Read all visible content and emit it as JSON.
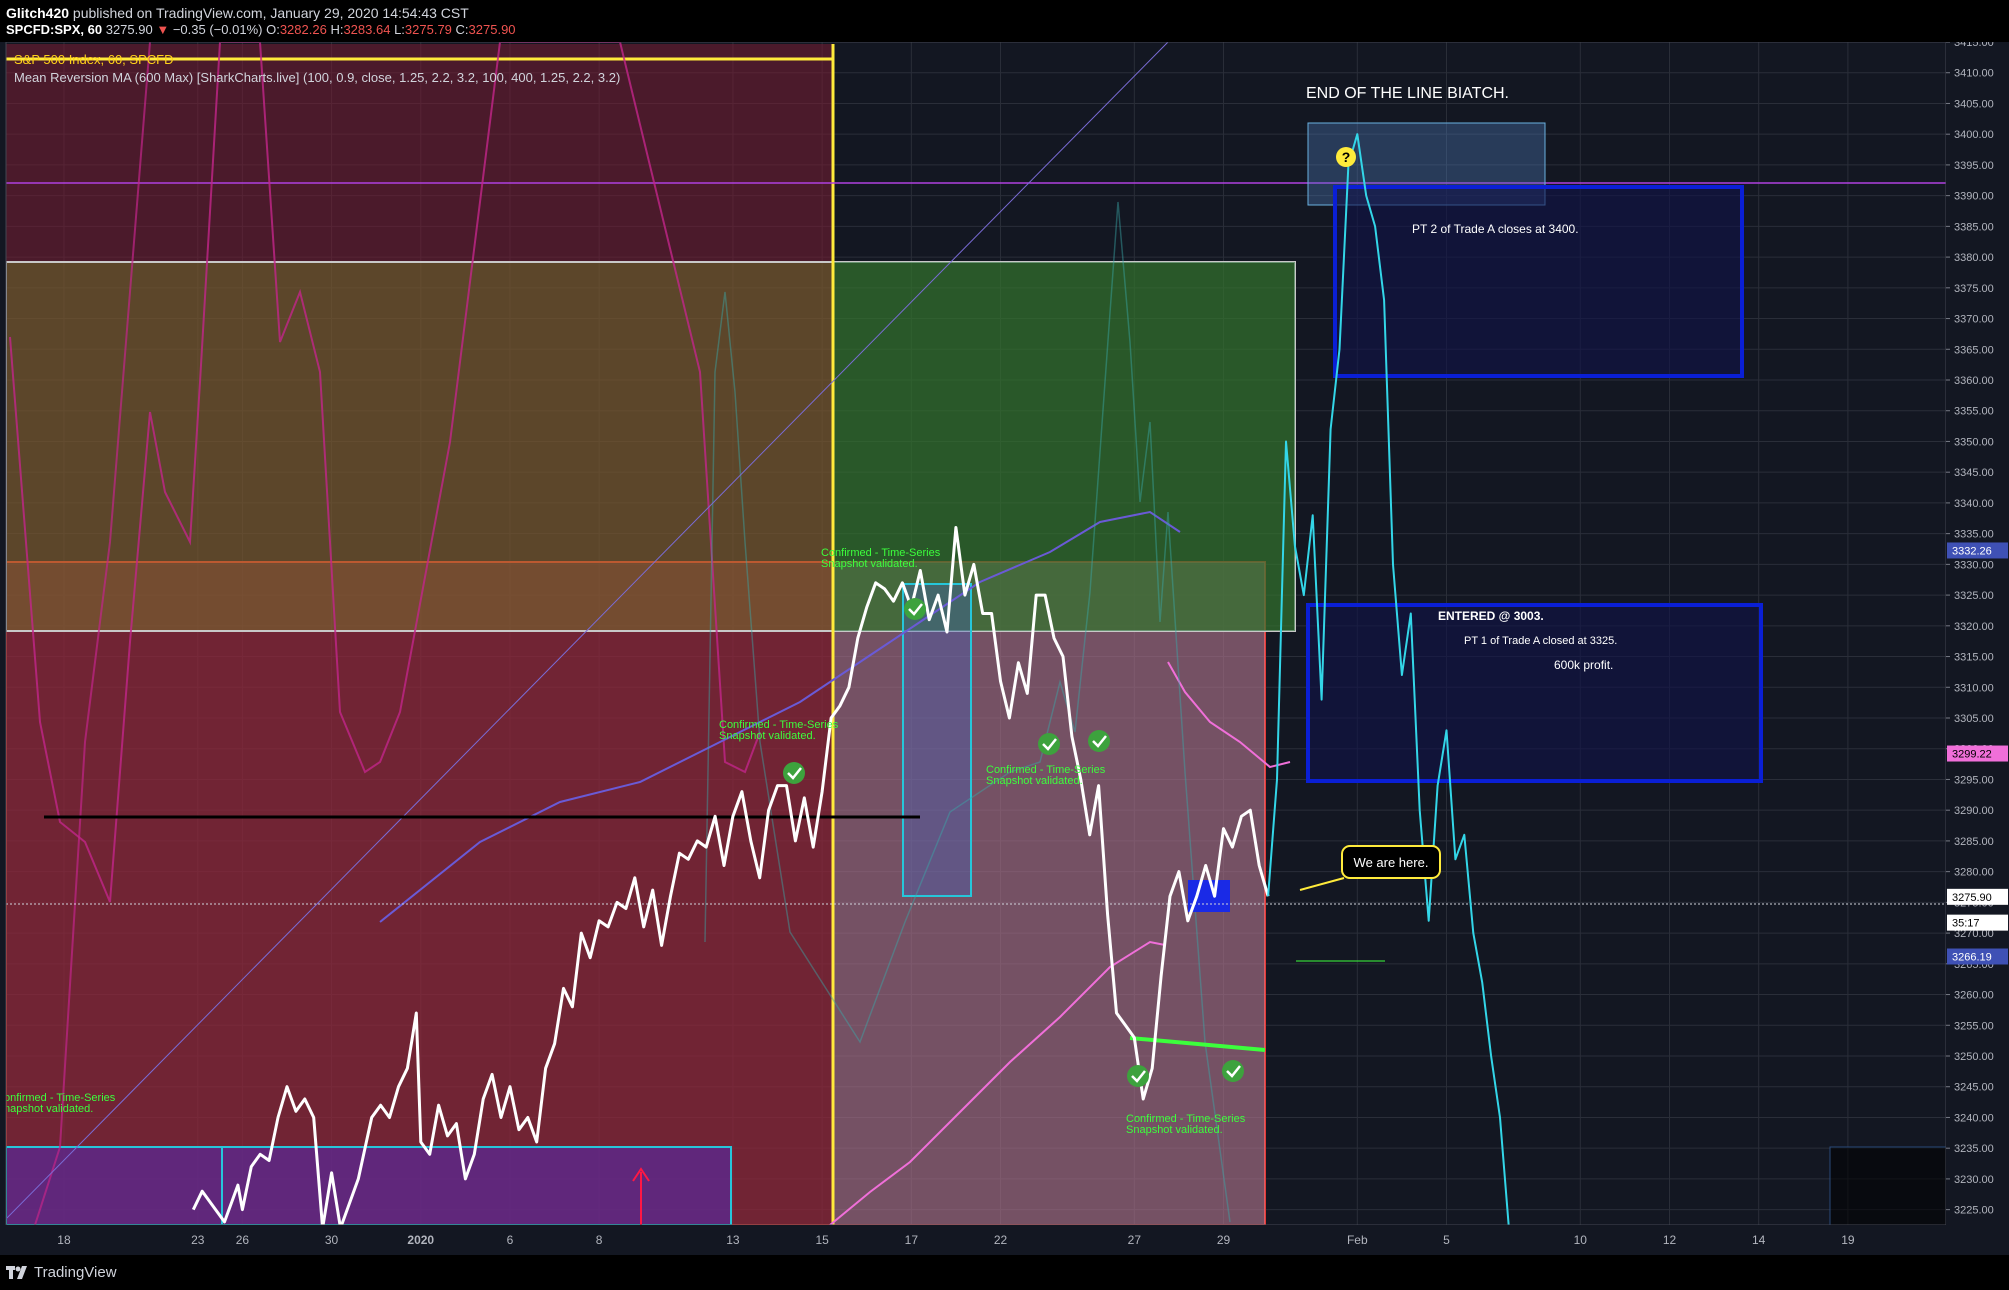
{
  "header": {
    "author": "Glitch420",
    "published": "published on TradingView.com, January 29, 2020 14:54:43 CST",
    "symbol": "SPCFD:SPX, 60",
    "last": "3275.90",
    "change_arrow": "▼",
    "change": "−0.35 (−0.01%)",
    "o_label": "O:",
    "o_value": "3282.26",
    "h_label": "H:",
    "h_value": "3283.64",
    "l_label": "L:",
    "l_value": "3275.79",
    "c_label": "C:",
    "c_value": "3275.90"
  },
  "legend": {
    "series_title": "S&P 500 Index, 60, SPCFD",
    "indicator": "Mean Reversion MA (600 Max) [SharkCharts.live] (100, 0.9, close, 1.25, 2.2, 3.2, 100, 400, 1.25, 2.2, 3.2)"
  },
  "footer": {
    "brand": "TradingView"
  },
  "colors": {
    "background": "#131722",
    "price_line": "#ffffff",
    "projection_line": "#33d6e8",
    "pink_band": "#e040fb",
    "yellow_zone": "#ffeb3b",
    "blue_box": "#0a1fd6",
    "confirm_text": "#3cff3c"
  },
  "chart_data": {
    "type": "line",
    "y_axis": {
      "range": [
        3222.5,
        3415
      ],
      "ticks": [
        3225,
        3230,
        3235,
        3240,
        3245,
        3250,
        3255,
        3260,
        3265,
        3270,
        3275,
        3280,
        3285,
        3290,
        3295,
        3300,
        3305,
        3310,
        3315,
        3320,
        3325,
        3330,
        3335,
        3340,
        3345,
        3350,
        3355,
        3360,
        3365,
        3370,
        3375,
        3380,
        3385,
        3390,
        3395,
        3400,
        3405,
        3410,
        3415
      ],
      "tick_labels": [
        "3225.00",
        "3230.00",
        "3235.00",
        "3240.00",
        "3245.00",
        "3250.00",
        "3255.00",
        "3260.00",
        "3265.00",
        "3270.00",
        "3275.00",
        "3280.00",
        "3285.00",
        "3290.00",
        "3295.00",
        "3300.00",
        "3305.00",
        "3310.00",
        "3315.00",
        "3320.00",
        "3325.00",
        "3330.00",
        "3335.00",
        "3340.00",
        "3345.00",
        "3350.00",
        "3355.00",
        "3360.00",
        "3365.00",
        "3370.00",
        "3375.00",
        "3380.00",
        "3385.00",
        "3390.00",
        "3395.00",
        "3400.00",
        "3405.00",
        "3410.00",
        "3415.00"
      ]
    },
    "x_axis": {
      "ticks": [
        {
          "label": "18",
          "t": 0
        },
        {
          "label": "23",
          "t": 3
        },
        {
          "label": "26",
          "t": 4
        },
        {
          "label": "30",
          "t": 6
        },
        {
          "label": "2020",
          "t": 8
        },
        {
          "label": "6",
          "t": 10
        },
        {
          "label": "8",
          "t": 12
        },
        {
          "label": "13",
          "t": 15
        },
        {
          "label": "15",
          "t": 17
        },
        {
          "label": "17",
          "t": 19
        },
        {
          "label": "22",
          "t": 21
        },
        {
          "label": "27",
          "t": 24
        },
        {
          "label": "29",
          "t": 26
        },
        {
          "label": "Feb",
          "t": 29
        },
        {
          "label": "5",
          "t": 31
        },
        {
          "label": "10",
          "t": 34
        },
        {
          "label": "12",
          "t": 36
        },
        {
          "label": "14",
          "t": 38
        },
        {
          "label": "19",
          "t": 40
        }
      ],
      "t_range": [
        -1.3,
        42.2
      ]
    },
    "series": [
      {
        "role": "price",
        "x": [
          2.9,
          3.1,
          3.3,
          3.6,
          3.9,
          4.0,
          4.2,
          4.4,
          4.6,
          4.8,
          5.0,
          5.2,
          5.4,
          5.6,
          5.8,
          6.0,
          6.2,
          6.6,
          6.9,
          7.1,
          7.3,
          7.5,
          7.7,
          7.9,
          8.0,
          8.2,
          8.4,
          8.6,
          8.8,
          9.0,
          9.2,
          9.4,
          9.6,
          9.8,
          10.0,
          10.2,
          10.4,
          10.6,
          10.8,
          11.0,
          11.2,
          11.4,
          11.6,
          11.8,
          12.0,
          12.2,
          12.4,
          12.6,
          12.8,
          13.0,
          13.2,
          13.4,
          13.6,
          13.8,
          14.0,
          14.2,
          14.4,
          14.6,
          14.8,
          15.0,
          15.2,
          15.4,
          15.6,
          15.8,
          16.0,
          16.2,
          16.4,
          16.6,
          16.8,
          17.0,
          17.2,
          17.4,
          17.6,
          17.8,
          18.0,
          18.2,
          18.4,
          18.6,
          18.8,
          19.0,
          19.2,
          19.4,
          19.6,
          19.8,
          20.0,
          20.2,
          20.4,
          20.6,
          20.8,
          21.0,
          21.2,
          21.4,
          21.6,
          21.8,
          22.0,
          22.2,
          22.4,
          22.6,
          22.8,
          23.0,
          23.2,
          23.4,
          23.6,
          23.8,
          24.0,
          24.2,
          24.4,
          24.6,
          24.8,
          25.0,
          25.2,
          25.4,
          25.6,
          25.8,
          26.0,
          26.2,
          26.4,
          26.6,
          26.8,
          27.0
        ],
        "y": [
          3225,
          3228,
          3226,
          3223,
          3229,
          3225,
          3232,
          3234,
          3233,
          3240,
          3245,
          3241,
          3243,
          3240,
          3222,
          3231,
          3222,
          3230,
          3240,
          3242,
          3240,
          3245,
          3248,
          3257,
          3236,
          3234,
          3242,
          3237,
          3239,
          3230,
          3234,
          3243,
          3247,
          3240,
          3245,
          3238,
          3240,
          3236,
          3248,
          3252,
          3261,
          3258,
          3270,
          3266,
          3272,
          3271,
          3275,
          3274,
          3279,
          3271,
          3277,
          3268,
          3276,
          3283,
          3282,
          3285,
          3284,
          3289,
          3281,
          3289,
          3293,
          3285,
          3279,
          3290,
          3294,
          3294,
          3285,
          3292,
          3284,
          3293,
          3305,
          3307,
          3310,
          3318,
          3323,
          3327,
          3326,
          3324,
          3327,
          3323,
          3329,
          3321,
          3325,
          3319,
          3336,
          3325,
          3330,
          3322,
          3322,
          3311,
          3305,
          3314,
          3309,
          3325,
          3325,
          3318,
          3315,
          3302,
          3295,
          3286,
          3294,
          3273,
          3257,
          3255,
          3253,
          3243,
          3248,
          3263,
          3276,
          3280,
          3272,
          3276,
          3281,
          3276,
          3287,
          3284,
          3289,
          3290,
          3281,
          3276
        ]
      },
      {
        "role": "projection",
        "x": [
          27.0,
          27.2,
          27.4,
          27.6,
          27.8,
          28.0,
          28.2,
          28.4,
          28.6,
          28.8,
          29.0,
          29.2,
          29.4,
          29.6,
          29.8,
          30.0,
          30.2,
          30.4,
          30.6,
          30.8,
          31.0,
          31.2,
          31.4,
          31.6,
          31.8,
          32.0,
          32.2,
          32.4,
          32.6,
          32.8,
          33.0
        ],
        "y": [
          3276,
          3295,
          3350,
          3333,
          3325,
          3338,
          3308,
          3352,
          3365,
          3395,
          3400,
          3390,
          3385,
          3373,
          3330,
          3312,
          3322,
          3290,
          3272,
          3294,
          3303,
          3282,
          3286,
          3270,
          3262,
          3250,
          3240,
          3222,
          3222,
          3222,
          3222
        ]
      }
    ],
    "price_labels": [
      "3332.26",
      "3299.22",
      "3275.90",
      "35:17",
      "3266.19"
    ],
    "annotations": {
      "title_note": "END OF THE LINE BIATCH.",
      "pt2": "PT 2 of Trade A closes at 3400.",
      "entered": "ENTERED @ 3003.",
      "pt1": "PT 1 of Trade A closed at 3325.",
      "profit": "600k profit.",
      "callout": "We are here.",
      "question": "?",
      "confirm_line1": "Confirmed - Time-Series",
      "confirm_line2": "Snapshot validated.",
      "confirm_left_line1": "onfirmed - Time-Series",
      "confirm_left_line2": "napshot validated."
    }
  }
}
